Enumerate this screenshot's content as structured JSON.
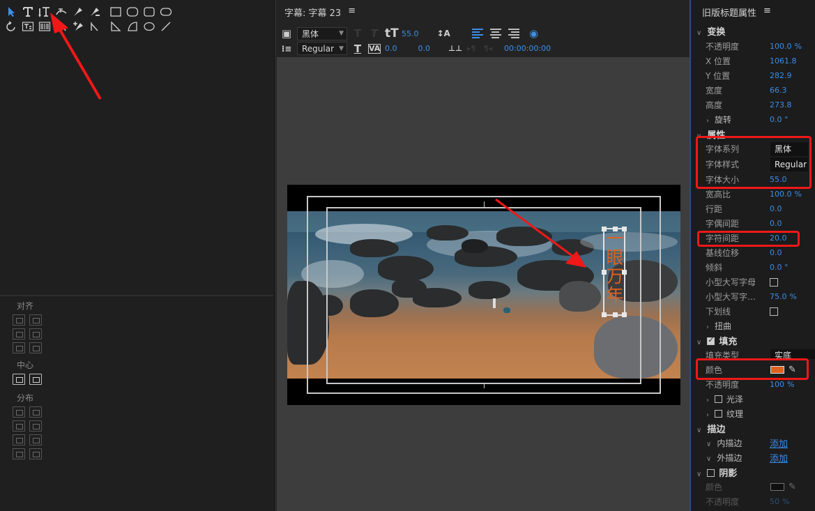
{
  "colors": {
    "accent": "#3d8ee6",
    "title_text": "#e0621f",
    "annotation": "#f01818",
    "fill_color": "#e0621f"
  },
  "tools": {
    "row1": [
      "selection-arrow-icon",
      "type-tool-icon",
      "vertical-type-tool-icon",
      "path-type-tool-icon",
      "pen-tool-icon",
      "delete-anchor-icon",
      "rectangle-icon",
      "ellipse-wide-icon",
      "rounded-rect-icon",
      "clipped-rect-icon"
    ],
    "row2": [
      "rotation-icon",
      "area-type-icon",
      "vertical-area-type-icon",
      "vertical-path-type-icon",
      "add-anchor-icon",
      "convert-anchor-icon",
      "wedge-icon",
      "arc-icon",
      "ellipse-icon",
      "line-icon"
    ]
  },
  "align_panel": {
    "align_label": "对齐",
    "center_label": "中心",
    "distribute_label": "分布"
  },
  "titler": {
    "tab_title": "字幕: 字幕 23",
    "menu_icon": "≡",
    "font_family": "黑体",
    "font_style": "Regular",
    "font_size": "55.0",
    "kerning": "0.0",
    "leading": "0.0",
    "timecode": "00:00:00:00",
    "title_text": "一眼万年"
  },
  "properties": {
    "panel_title": "旧版标题属性",
    "menu_icon": "≡",
    "transform": {
      "label": "变换",
      "opacity": {
        "label": "不透明度",
        "value": "100.0",
        "unit": "%"
      },
      "x": {
        "label": "X 位置",
        "value": "1061.8"
      },
      "y": {
        "label": "Y 位置",
        "value": "282.9"
      },
      "width": {
        "label": "宽度",
        "value": "66.3"
      },
      "height": {
        "label": "高度",
        "value": "273.8"
      },
      "rotation": {
        "label": "旋转",
        "value": "0.0 °"
      }
    },
    "attributes": {
      "label": "属性",
      "font_family": {
        "label": "字体系列",
        "value": "黑体"
      },
      "font_style": {
        "label": "字体样式",
        "value": "Regular"
      },
      "font_size": {
        "label": "字体大小",
        "value": "55.0"
      },
      "aspect": {
        "label": "宽高比",
        "value": "100.0",
        "unit": "%"
      },
      "leading": {
        "label": "行距",
        "value": "0.0"
      },
      "kerning": {
        "label": "字偶间距",
        "value": "0.0"
      },
      "tracking": {
        "label": "字符间距",
        "value": "20.0"
      },
      "baseline": {
        "label": "基线位移",
        "value": "0.0"
      },
      "slant": {
        "label": "倾斜",
        "value": "0.0 °"
      },
      "small_caps": {
        "label": "小型大写字母"
      },
      "small_caps_size": {
        "label": "小型大写字…",
        "value": "75.0",
        "unit": "%"
      },
      "underline": {
        "label": "下划线"
      },
      "distort": {
        "label": "扭曲"
      }
    },
    "fill": {
      "label": "填充",
      "fill_type": {
        "label": "填充类型",
        "value": "实底"
      },
      "color": {
        "label": "颜色"
      },
      "opacity": {
        "label": "不透明度",
        "value": "100",
        "unit": "%"
      },
      "sheen": {
        "label": "光泽"
      },
      "texture": {
        "label": "纹理"
      }
    },
    "stroke": {
      "label": "描边",
      "inner": {
        "label": "内描边",
        "link": "添加"
      },
      "outer": {
        "label": "外描边",
        "link": "添加"
      }
    },
    "shadow": {
      "label": "阴影",
      "color": {
        "label": "颜色"
      },
      "opacity": {
        "label": "不透明度",
        "value": "50",
        "unit": "%"
      }
    }
  }
}
